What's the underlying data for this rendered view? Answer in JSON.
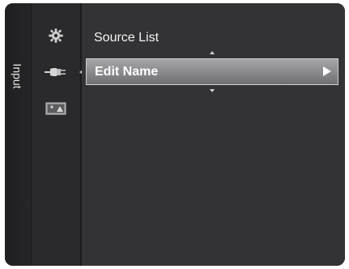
{
  "category": {
    "label": "Input"
  },
  "icons": [
    {
      "name": "settings-icon"
    },
    {
      "name": "input-plug-icon",
      "selected": true
    },
    {
      "name": "picture-icon"
    }
  ],
  "menu": {
    "items": [
      {
        "label": "Source List"
      },
      {
        "label": "Edit Name",
        "highlighted": true
      }
    ]
  },
  "colors": {
    "panel_bg": "#2b2b2d",
    "menu_bg": "#333335",
    "highlight": "#8a8a8d",
    "text": "#f4f4f4"
  }
}
